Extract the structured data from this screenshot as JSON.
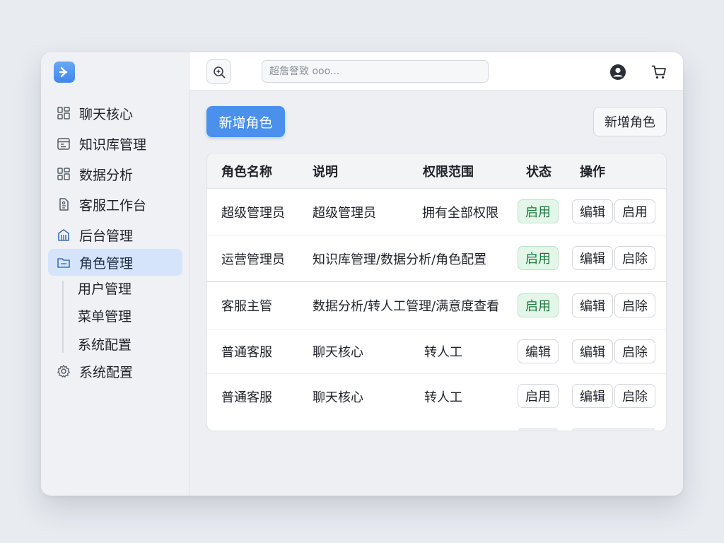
{
  "sidebar": {
    "items": [
      {
        "label": "聊天核心",
        "icon": "grid-icon"
      },
      {
        "label": "知识库管理",
        "icon": "calendar-icon"
      },
      {
        "label": "数据分析",
        "icon": "grid-icon"
      },
      {
        "label": "客服工作台",
        "icon": "document-icon"
      },
      {
        "label": "后台管理",
        "icon": "building-icon"
      },
      {
        "label": "角色管理",
        "icon": "folder-icon",
        "active": true
      }
    ],
    "sub_items": [
      "用户管理",
      "菜单管理",
      "系统配置"
    ],
    "settings": {
      "label": "系统配置",
      "icon": "gear-icon"
    }
  },
  "topbar": {
    "search_placeholder": "超詹詧致 ooo..."
  },
  "toolbar": {
    "primary_label": "新增角色",
    "secondary_label": "新增角色"
  },
  "table": {
    "headers": [
      "角色名称",
      "说明",
      "权限范围",
      "状态",
      "操作"
    ],
    "rows": [
      {
        "name": "超级管理员",
        "desc": "超级管理员",
        "scope": "拥有全部权限",
        "status": "启用",
        "status_on": true,
        "edit": "编辑",
        "action": "启用"
      },
      {
        "name": "运营管理员",
        "desc": "知识库管理/数据分析/角色配置",
        "scope": "",
        "status": "启用",
        "status_on": true,
        "edit": "编辑",
        "action": "启除"
      },
      {
        "name": "客服主管",
        "desc": "数据分析/转人工管理/满意度查看",
        "scope": "",
        "status": "启用",
        "status_on": true,
        "edit": "编辑",
        "action": "启除"
      },
      {
        "name": "普通客服",
        "desc": "聊天核心",
        "scope": "转人工",
        "status": "编辑",
        "status_on": false,
        "edit": "编辑",
        "action": "启除"
      },
      {
        "name": "普通客服",
        "desc": "聊天核心",
        "scope": "转人工",
        "status": "启用",
        "status_on": false,
        "edit": "编辑",
        "action": "启除"
      }
    ]
  },
  "colors": {
    "accent": "#4a90ec",
    "active_nav": "#d6e4fb",
    "status_on_bg": "#e4f6e9",
    "status_on_text": "#1c7a3c"
  }
}
